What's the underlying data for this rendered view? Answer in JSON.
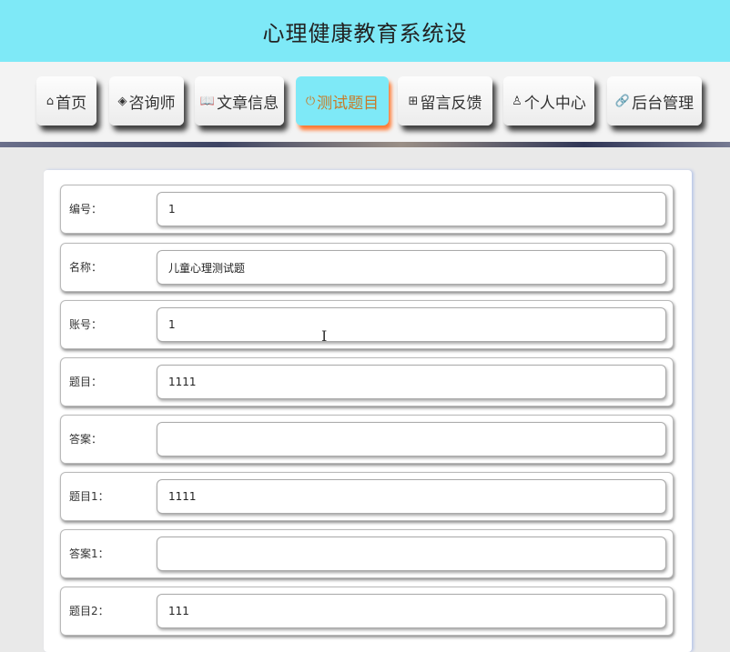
{
  "site_title": "心理健康教育系统设",
  "nav": [
    {
      "label": "首页",
      "icon": "home-icon",
      "glyph": "⌂",
      "active": false
    },
    {
      "label": "咨询师",
      "icon": "layers-icon",
      "glyph": "◈",
      "active": false
    },
    {
      "label": "文章信息",
      "icon": "book-icon",
      "glyph": "📖",
      "active": false
    },
    {
      "label": "测试题目",
      "icon": "power-icon",
      "glyph": "⏻",
      "active": true
    },
    {
      "label": "留言反馈",
      "icon": "grid-icon",
      "glyph": "⊞",
      "active": false
    },
    {
      "label": "个人中心",
      "icon": "user-icon",
      "glyph": "♙",
      "active": false
    },
    {
      "label": "后台管理",
      "icon": "link-icon",
      "glyph": "🔗",
      "active": false
    }
  ],
  "form": {
    "fields": [
      {
        "label": "编号：",
        "value": "1"
      },
      {
        "label": "名称：",
        "value": "儿童心理测试题"
      },
      {
        "label": "账号：",
        "value": "1"
      },
      {
        "label": "题目：",
        "value": "1111"
      },
      {
        "label": "答案：",
        "value": ""
      },
      {
        "label": "题目1：",
        "value": "1111"
      },
      {
        "label": "答案1：",
        "value": ""
      },
      {
        "label": "题目2：",
        "value": "111"
      }
    ]
  },
  "colors": {
    "header_bg": "#7ee9f7",
    "active_nav_bg": "#7ee9f7",
    "active_nav_text": "#c77c2a",
    "active_nav_shadow": "#ff7a33"
  }
}
